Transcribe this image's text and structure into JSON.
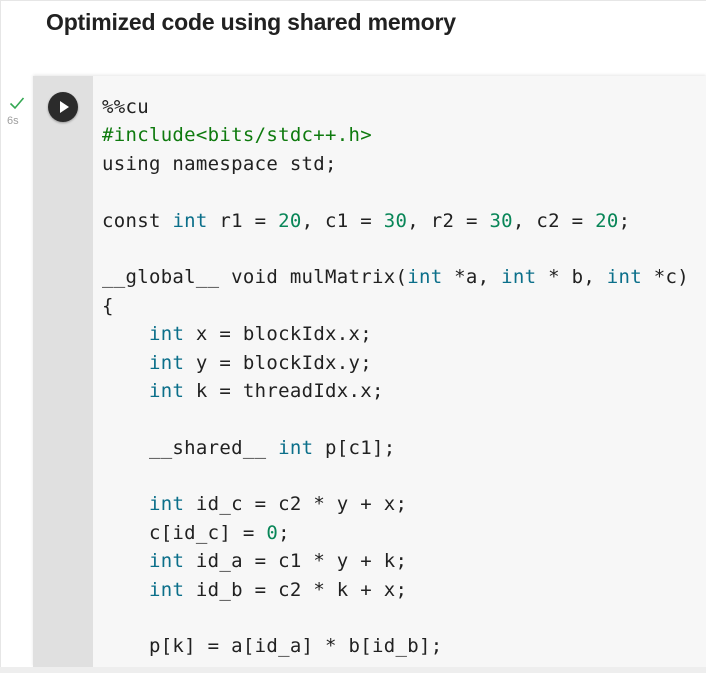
{
  "page": {
    "heading": "Optimized code using shared memory"
  },
  "cell": {
    "run_button_label": "Run cell",
    "status_icon": "check-icon",
    "exec_time": "6s",
    "colors": {
      "keyword": "#0b6f8a",
      "number": "#098658",
      "preprocessor": "#0e7a0e",
      "text": "#212121",
      "status_ok": "#34a853"
    },
    "code_lines": [
      [
        {
          "t": "%%cu",
          "c": "plain"
        }
      ],
      [
        {
          "t": "#include<bits/stdc++.h>",
          "c": "pp"
        }
      ],
      [
        {
          "t": "using namespace std;",
          "c": "plain"
        }
      ],
      [],
      [
        {
          "t": "const ",
          "c": "plain"
        },
        {
          "t": "int",
          "c": "kw"
        },
        {
          "t": " r1 = ",
          "c": "plain"
        },
        {
          "t": "20",
          "c": "num"
        },
        {
          "t": ", c1 = ",
          "c": "plain"
        },
        {
          "t": "30",
          "c": "num"
        },
        {
          "t": ", r2 = ",
          "c": "plain"
        },
        {
          "t": "30",
          "c": "num"
        },
        {
          "t": ", c2 = ",
          "c": "plain"
        },
        {
          "t": "20",
          "c": "num"
        },
        {
          "t": ";",
          "c": "plain"
        }
      ],
      [],
      [
        {
          "t": "__global__ void mulMatrix(",
          "c": "plain"
        },
        {
          "t": "int",
          "c": "kw"
        },
        {
          "t": " *a, ",
          "c": "plain"
        },
        {
          "t": "int",
          "c": "kw"
        },
        {
          "t": " * b, ",
          "c": "plain"
        },
        {
          "t": "int",
          "c": "kw"
        },
        {
          "t": " *c)",
          "c": "plain"
        }
      ],
      [
        {
          "t": "{",
          "c": "plain"
        }
      ],
      [
        {
          "t": "    ",
          "c": "plain"
        },
        {
          "t": "int",
          "c": "kw"
        },
        {
          "t": " x = blockIdx.x;",
          "c": "plain"
        }
      ],
      [
        {
          "t": "    ",
          "c": "plain"
        },
        {
          "t": "int",
          "c": "kw"
        },
        {
          "t": " y = blockIdx.y;",
          "c": "plain"
        }
      ],
      [
        {
          "t": "    ",
          "c": "plain"
        },
        {
          "t": "int",
          "c": "kw"
        },
        {
          "t": " k = threadIdx.x;",
          "c": "plain"
        }
      ],
      [],
      [
        {
          "t": "    __shared__ ",
          "c": "plain"
        },
        {
          "t": "int",
          "c": "kw"
        },
        {
          "t": " p[c1];",
          "c": "plain"
        }
      ],
      [],
      [
        {
          "t": "    ",
          "c": "plain"
        },
        {
          "t": "int",
          "c": "kw"
        },
        {
          "t": " id_c = c2 * y + x;",
          "c": "plain"
        }
      ],
      [
        {
          "t": "    c[id_c] = ",
          "c": "plain"
        },
        {
          "t": "0",
          "c": "num"
        },
        {
          "t": ";",
          "c": "plain"
        }
      ],
      [
        {
          "t": "    ",
          "c": "plain"
        },
        {
          "t": "int",
          "c": "kw"
        },
        {
          "t": " id_a = c1 * y + k;",
          "c": "plain"
        }
      ],
      [
        {
          "t": "    ",
          "c": "plain"
        },
        {
          "t": "int",
          "c": "kw"
        },
        {
          "t": " id_b = c2 * k + x;",
          "c": "plain"
        }
      ],
      [],
      [
        {
          "t": "    p[k] = a[id_a] * b[id_b];",
          "c": "plain"
        }
      ]
    ]
  }
}
